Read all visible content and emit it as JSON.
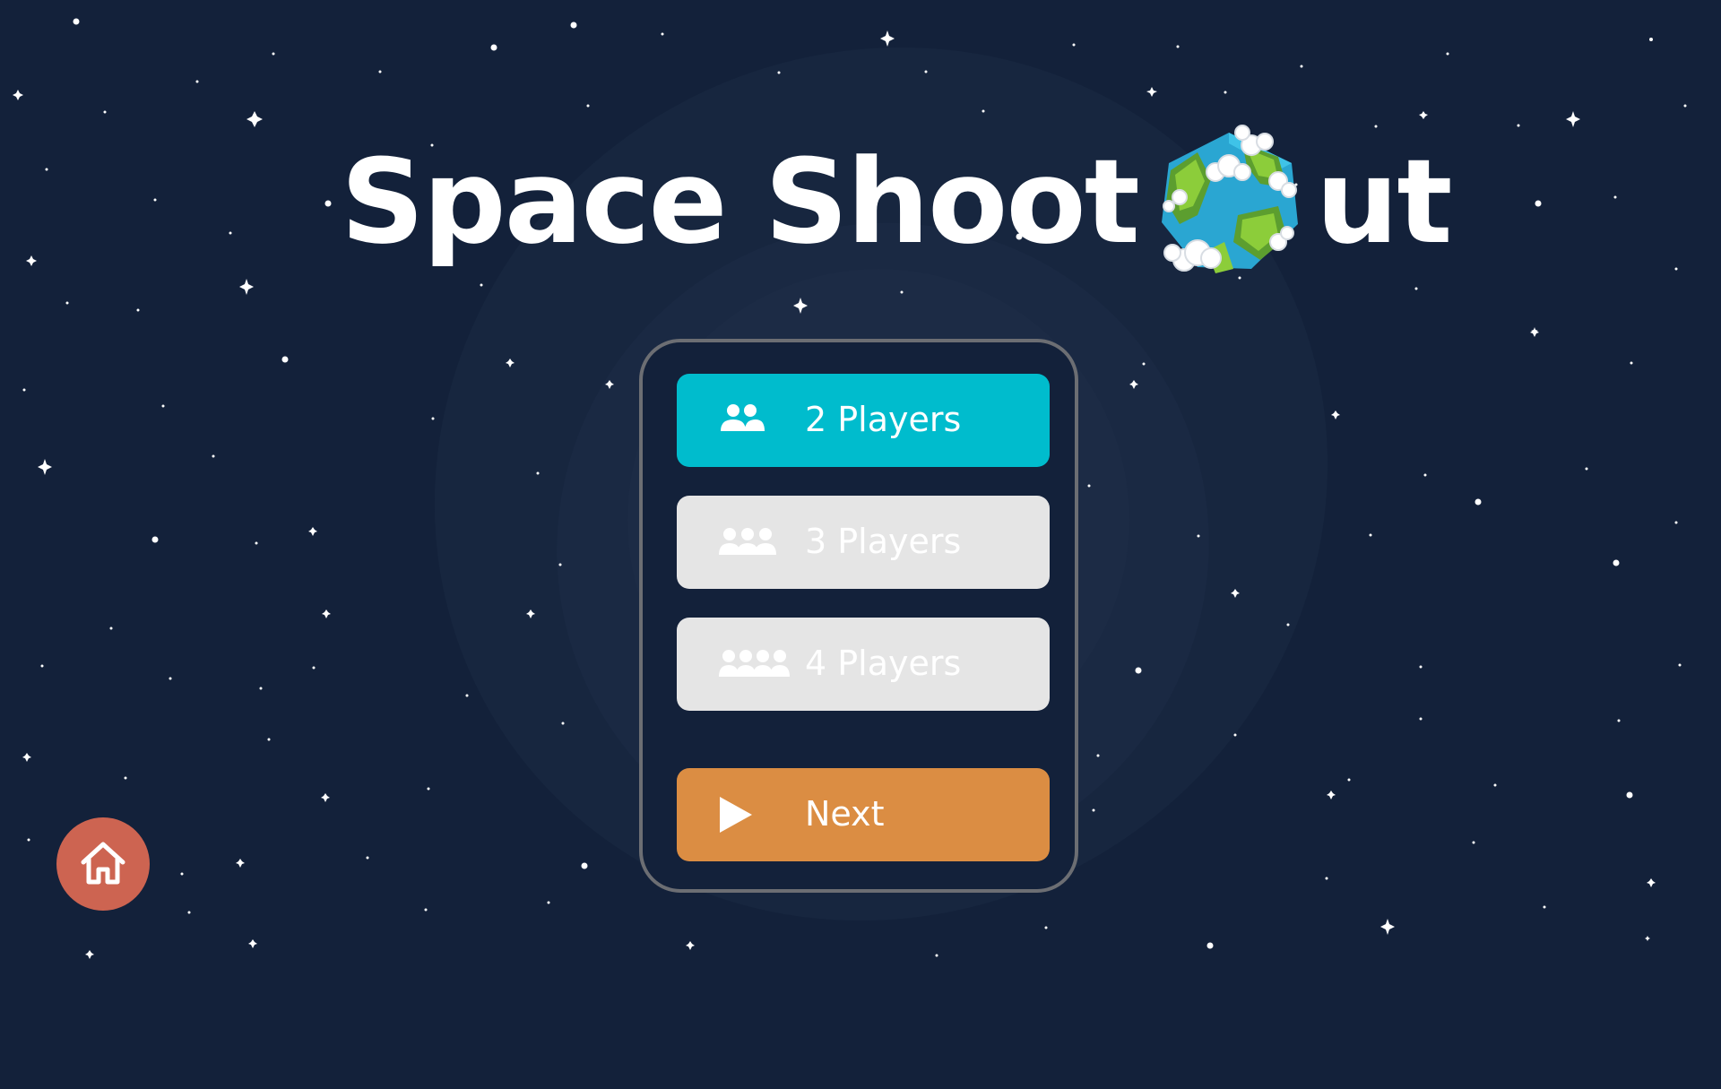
{
  "game": {
    "title_part1": "Space Shoot",
    "title_part2": "ut",
    "globe_icon": "earth-globe-icon"
  },
  "player_select": {
    "options": [
      {
        "label": "2 Players",
        "icon": "two-players-icon",
        "state": "selected"
      },
      {
        "label": "3 Players",
        "icon": "three-players-icon",
        "state": "disabled"
      },
      {
        "label": "4 Players",
        "icon": "four-players-icon",
        "state": "disabled"
      }
    ],
    "next_label": "Next",
    "next_icon": "play-icon"
  },
  "home_button": {
    "icon": "home-icon"
  },
  "colors": {
    "background": "#13213a",
    "selected": "#00bccd",
    "disabled": "#e5e5e5",
    "next": "#db8d43",
    "home": "#cd6451",
    "panel_border": "#6c6e73"
  }
}
